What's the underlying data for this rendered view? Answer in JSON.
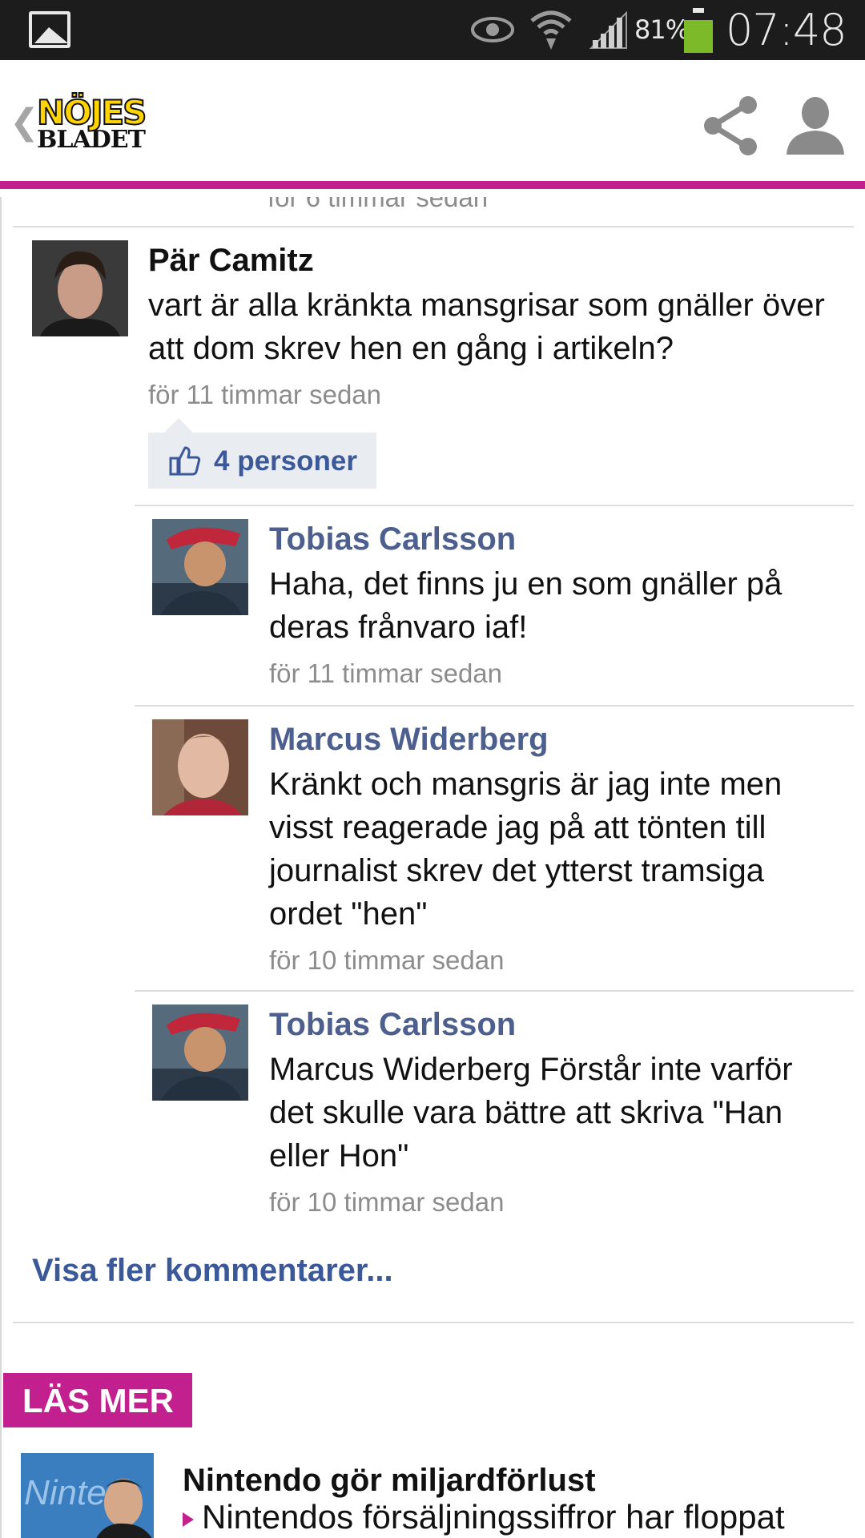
{
  "status_bar": {
    "battery_percent": "81%",
    "battery_level": 0.81,
    "time": "07:48",
    "battery_color": "#7cba2a"
  },
  "header": {
    "logo_line1": "NÖJES",
    "logo_line2": "BLADET",
    "accent_color": "#c21f8f",
    "icons": [
      "back-chevron-icon",
      "share-icon",
      "profile-icon"
    ]
  },
  "comments": {
    "clipped_time": "för 6 timmar sedan",
    "main": {
      "author": "Pär Camitz",
      "text": "vart är alla kränkta mansgrisar som gnäller över att dom skrev hen en gång i artikeln?",
      "time": "för 11 timmar sedan",
      "likes": "4 personer"
    },
    "replies": [
      {
        "author": "Tobias Carlsson",
        "text": "Haha, det finns ju en som gnäller på deras frånvaro iaf!",
        "time": "för 11 timmar sedan"
      },
      {
        "author": "Marcus Widerberg",
        "text": "Kränkt och mansgris är jag inte men visst reagerade jag på att tönten till journalist skrev det ytterst tramsiga ordet \"hen\"",
        "time": "för 10 timmar sedan"
      },
      {
        "author": "Tobias Carlsson",
        "text": "Marcus Widerberg Förstår inte varför det skulle vara bättre att skriva \"Han eller Hon\"",
        "time": "för 10 timmar sedan"
      }
    ],
    "more_link": "Visa fler kommentarer..."
  },
  "read_more": {
    "label": "LÄS MER",
    "article_title": "Nintendo gör miljardförlust",
    "article_lead": "Nintendos försäljningssiffror har floppat"
  }
}
